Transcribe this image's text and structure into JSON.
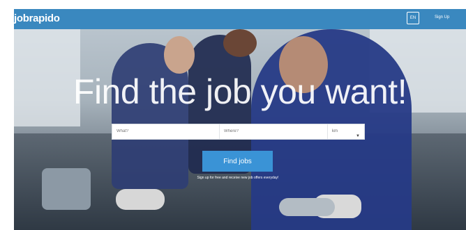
{
  "header": {
    "logo": "jobrapido",
    "language_label": "EN",
    "signup_label": "Sign Up"
  },
  "hero": {
    "headline": "Find the job you want!",
    "search": {
      "what_placeholder": "What?",
      "where_placeholder": "Where?",
      "radius_value": "km"
    },
    "find_button": "Find jobs",
    "subtext": "Sign up for free and receive new job offers everyday!"
  },
  "colors": {
    "header": "#3a88bf",
    "button": "#3a93d6"
  }
}
